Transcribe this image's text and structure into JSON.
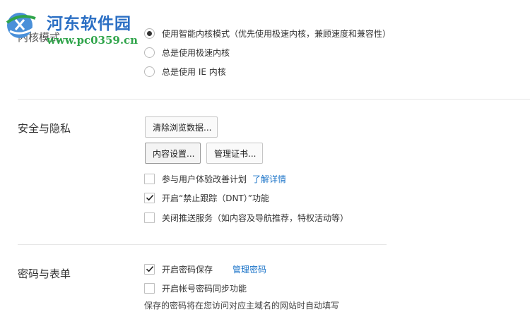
{
  "watermark": {
    "title": "河东软件园",
    "url": "www.pc0359.cn"
  },
  "kernel": {
    "title": "内核模式",
    "options": [
      {
        "label": "使用智能内核模式（优先使用极速内核，兼顾速度和兼容性）",
        "checked": true
      },
      {
        "label": "总是使用极速内核",
        "checked": false
      },
      {
        "label": "总是使用 IE 内核",
        "checked": false
      }
    ]
  },
  "security": {
    "title": "安全与隐私",
    "clear_button": "清除浏览数据...",
    "content_settings_button": "内容设置...",
    "certificates_button": "管理证书...",
    "checks": [
      {
        "label": "参与用户体验改善计划",
        "checked": false,
        "link": "了解详情"
      },
      {
        "label": "开启“禁止跟踪（DNT）”功能",
        "checked": true
      },
      {
        "label": "关闭推送服务（如内容及导航推荐，特权活动等）",
        "checked": false
      }
    ]
  },
  "passwords": {
    "title": "密码与表单",
    "checks": [
      {
        "label": "开启密码保存",
        "checked": true,
        "link": "管理密码"
      },
      {
        "label": "开启帐号密码同步功能",
        "checked": false
      }
    ],
    "note": "保存的密码将在您访问对应主域名的网站时自动填写"
  }
}
